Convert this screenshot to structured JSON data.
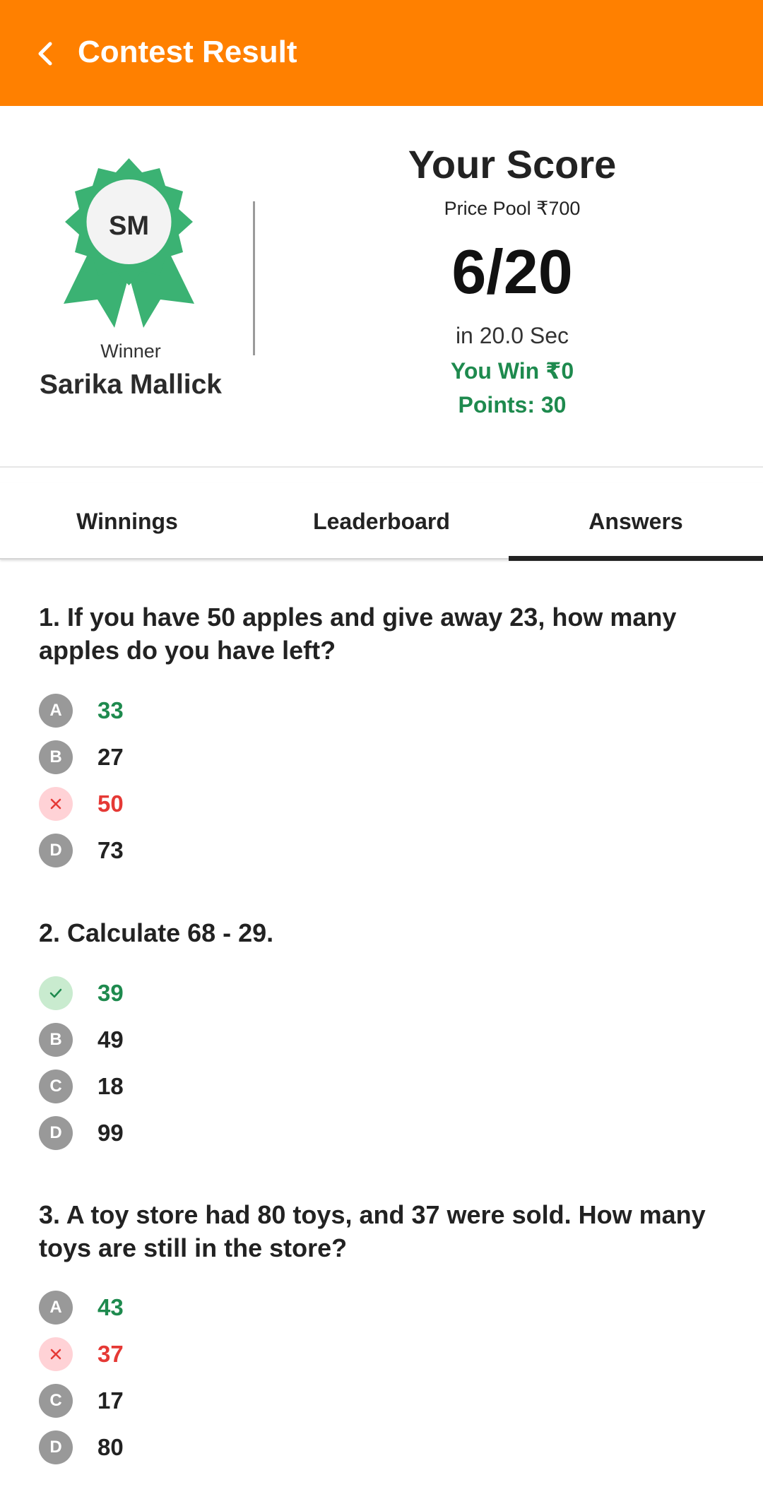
{
  "header": {
    "title": "Contest Result",
    "back_icon": "chevron-left-icon",
    "bg_color": "#FF8000"
  },
  "winner": {
    "initials": "SM",
    "label": "Winner",
    "name": "Sarika Mallick",
    "badge_icon": "award-rosette-icon",
    "badge_color": "#3BB273"
  },
  "score": {
    "title": "Your Score",
    "prize_pool": "Price Pool ₹700",
    "value": "6/20",
    "time": "in 20.0 Sec",
    "win": "You Win ₹0",
    "points": "Points: 30",
    "accent_color": "#1E8A4E"
  },
  "tabs": [
    {
      "label": "Winnings",
      "active": false
    },
    {
      "label": "Leaderboard",
      "active": false
    },
    {
      "label": "Answers",
      "active": true
    }
  ],
  "questions": [
    {
      "text": "1. If you have 50 apples and give away 23, how many apples do you have left?",
      "options": [
        {
          "marker": "A",
          "text": "33",
          "state": "correct"
        },
        {
          "marker": "B",
          "text": "27",
          "state": "neutral"
        },
        {
          "marker": "×",
          "text": "50",
          "state": "wrong"
        },
        {
          "marker": "D",
          "text": "73",
          "state": "neutral"
        }
      ]
    },
    {
      "text": "2. Calculate 68 - 29.",
      "options": [
        {
          "marker": "✓",
          "text": "39",
          "state": "right"
        },
        {
          "marker": "B",
          "text": "49",
          "state": "neutral"
        },
        {
          "marker": "C",
          "text": "18",
          "state": "neutral"
        },
        {
          "marker": "D",
          "text": "99",
          "state": "neutral"
        }
      ]
    },
    {
      "text": "3. A toy store had 80 toys, and 37 were sold. How many toys are still in the store?",
      "options": [
        {
          "marker": "A",
          "text": "43",
          "state": "correct"
        },
        {
          "marker": "×",
          "text": "37",
          "state": "wrong"
        },
        {
          "marker": "C",
          "text": "17",
          "state": "neutral"
        },
        {
          "marker": "D",
          "text": "80",
          "state": "neutral"
        }
      ]
    }
  ]
}
